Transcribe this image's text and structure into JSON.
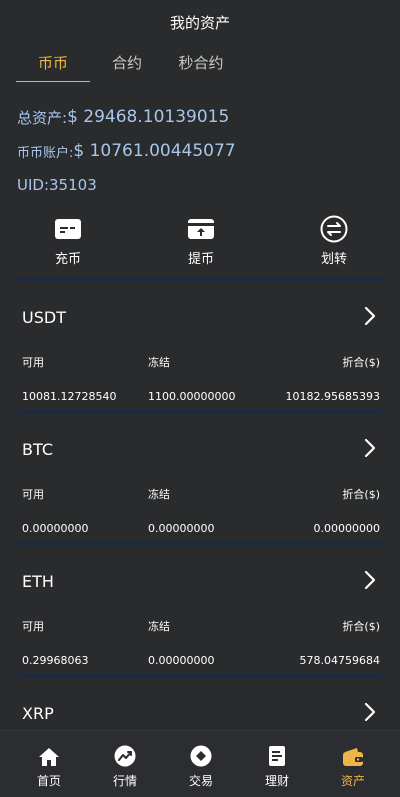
{
  "header": {
    "title": "我的资产"
  },
  "tabs": [
    {
      "label": "币币",
      "active": true
    },
    {
      "label": "合约",
      "active": false
    },
    {
      "label": "秒合约",
      "active": false
    }
  ],
  "summary": {
    "total_label": "总资产:",
    "total_value": "$ 29468.10139015",
    "account_label": "币币账户:",
    "account_value": "$ 10761.00445077",
    "uid_label": "UID:",
    "uid_value": "35103"
  },
  "actions": [
    {
      "label": "充币",
      "icon": "deposit-card-icon"
    },
    {
      "label": "提币",
      "icon": "withdraw-card-icon"
    },
    {
      "label": "划转",
      "icon": "transfer-icon"
    }
  ],
  "coins": [
    {
      "name": "USDT",
      "available_label": "可用",
      "frozen_label": "冻结",
      "value_label": "折合($)",
      "available": "10081.12728540",
      "frozen": "1100.00000000",
      "value": "10182.95685393"
    },
    {
      "name": "BTC",
      "available_label": "可用",
      "frozen_label": "冻结",
      "value_label": "折合($)",
      "available": "0.00000000",
      "frozen": "0.00000000",
      "value": "0.00000000"
    },
    {
      "name": "ETH",
      "available_label": "可用",
      "frozen_label": "冻结",
      "value_label": "折合($)",
      "available": "0.29968063",
      "frozen": "0.00000000",
      "value": "578.04759684"
    },
    {
      "name": "XRP"
    }
  ],
  "tabbar": [
    {
      "label": "首页",
      "icon": "home-icon",
      "active": false
    },
    {
      "label": "行情",
      "icon": "market-trend-icon",
      "active": false
    },
    {
      "label": "交易",
      "icon": "trade-icon",
      "active": false
    },
    {
      "label": "理财",
      "icon": "finance-doc-icon",
      "active": false
    },
    {
      "label": "资产",
      "icon": "wallet-icon",
      "active": true
    }
  ],
  "colors": {
    "background": "#2a2b2d",
    "accent": "#f0b54a",
    "summary_text": "#a8c6ea",
    "divider": "#1d2a44"
  }
}
